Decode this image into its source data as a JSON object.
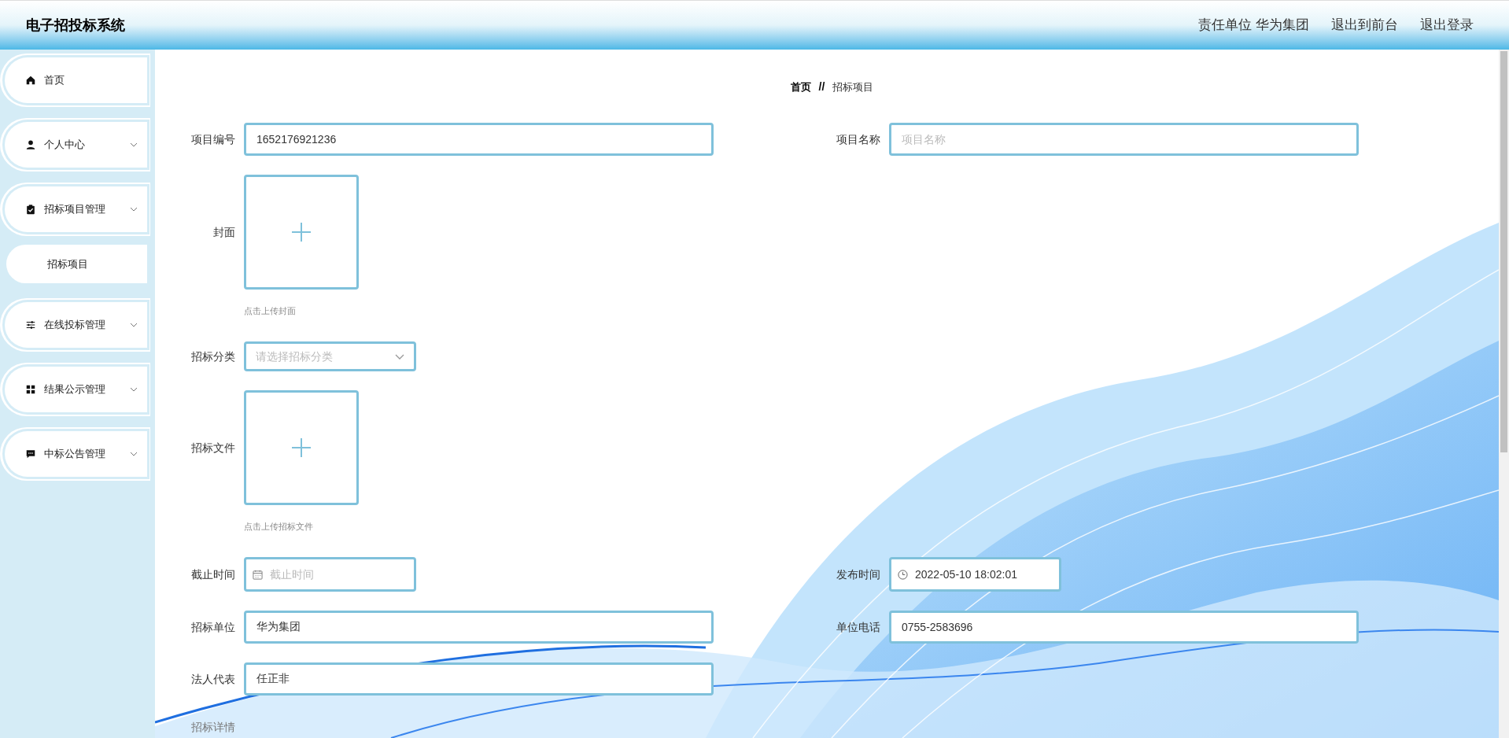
{
  "header": {
    "title": "电子招投标系统",
    "links": [
      {
        "label": "责任单位 华为集团"
      },
      {
        "label": "退出到前台"
      },
      {
        "label": "退出登录"
      }
    ]
  },
  "sidebar": {
    "items": [
      {
        "label": "首页",
        "expandable": false
      },
      {
        "label": "个人中心",
        "expandable": true
      },
      {
        "label": "招标项目管理",
        "expandable": true,
        "children": [
          {
            "label": "招标项目"
          }
        ]
      },
      {
        "label": "在线投标管理",
        "expandable": true
      },
      {
        "label": "结果公示管理",
        "expandable": true
      },
      {
        "label": "中标公告管理",
        "expandable": true
      }
    ]
  },
  "breadcrumb": [
    {
      "label": "首页"
    },
    {
      "label": "招标项目"
    }
  ],
  "breadcrumb_separator": "//",
  "form": {
    "rows": [
      [
        {
          "label": "项目编号",
          "kind": "text",
          "value": "1652176921236"
        },
        {
          "label": "项目名称",
          "kind": "text",
          "placeholder": "项目名称"
        }
      ],
      [
        {
          "label": "封面",
          "kind": "upload",
          "hint": "点击上传封面"
        }
      ],
      [
        {
          "label": "招标分类",
          "kind": "select",
          "placeholder": "请选择招标分类"
        }
      ],
      [
        {
          "label": "招标文件",
          "kind": "upload",
          "hint": "点击上传招标文件"
        }
      ],
      [
        {
          "label": "截止时间",
          "kind": "date",
          "placeholder": "截止时间"
        },
        {
          "label": "发布时间",
          "kind": "datetime",
          "value": "2022-05-10 18:02:01"
        }
      ],
      [
        {
          "label": "招标单位",
          "kind": "text",
          "value": "华为集团"
        },
        {
          "label": "单位电话",
          "kind": "text",
          "value": "0755-2583696"
        }
      ],
      [
        {
          "label": "法人代表",
          "kind": "text",
          "value": "任正非"
        }
      ],
      [
        {
          "label": "招标详情",
          "kind": "editor"
        }
      ]
    ]
  }
}
